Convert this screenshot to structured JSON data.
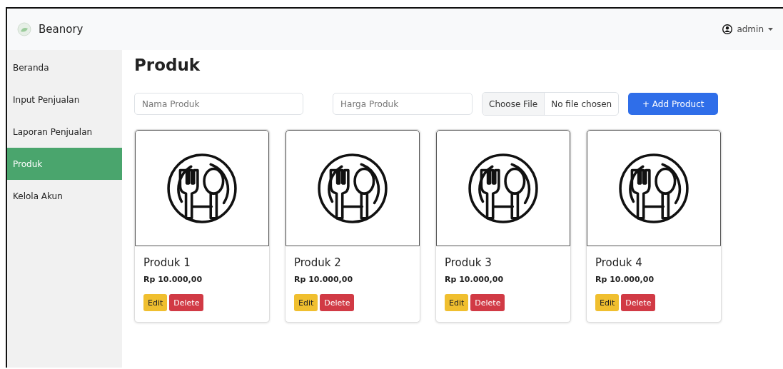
{
  "navbar": {
    "brand": "Beanory",
    "user": "admin"
  },
  "sidebar": {
    "items": [
      {
        "label": "Beranda",
        "selected": false
      },
      {
        "label": "Input Penjualan",
        "selected": false
      },
      {
        "label": "Laporan Penjualan",
        "selected": false
      },
      {
        "label": "Produk",
        "selected": true
      },
      {
        "label": "Kelola Akun",
        "selected": false
      }
    ]
  },
  "page": {
    "title": "Produk"
  },
  "form": {
    "name_placeholder": "Nama Produk",
    "price_placeholder": "Harga Produk",
    "file_button": "Choose File",
    "file_status": "No file chosen",
    "submit": "+ Add Product"
  },
  "products": [
    {
      "name": "Produk 1",
      "price": "Rp 10.000,00",
      "edit": "Edit",
      "delete": "Delete"
    },
    {
      "name": "Produk 2",
      "price": "Rp 10.000,00",
      "edit": "Edit",
      "delete": "Delete"
    },
    {
      "name": "Produk 3",
      "price": "Rp 10.000,00",
      "edit": "Edit",
      "delete": "Delete"
    },
    {
      "name": "Produk 4",
      "price": "Rp 10.000,00",
      "edit": "Edit",
      "delete": "Delete"
    }
  ]
}
